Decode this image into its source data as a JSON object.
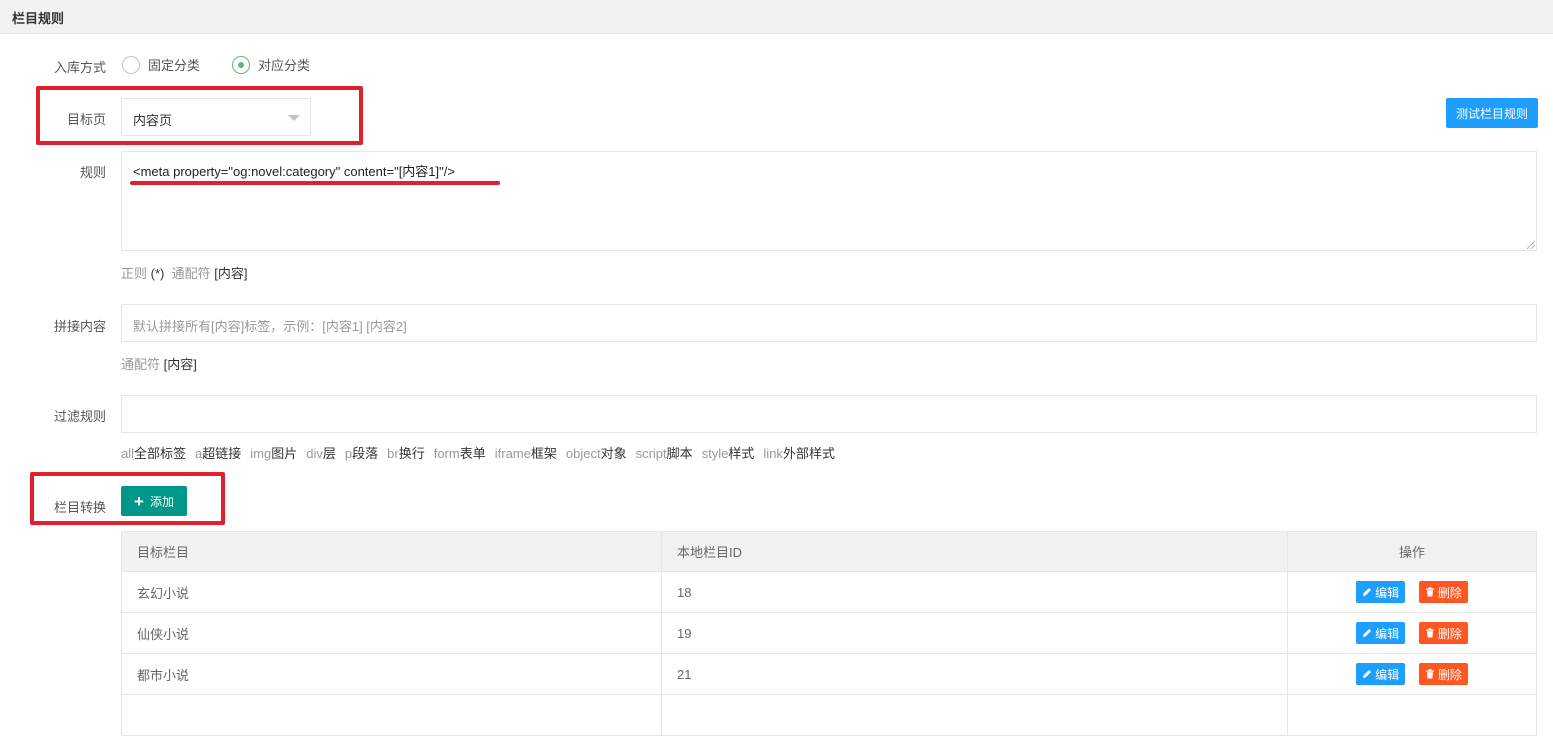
{
  "header": {
    "title": "栏目规则"
  },
  "storage_mode": {
    "label": "入库方式",
    "options": [
      {
        "label": "固定分类",
        "checked": false
      },
      {
        "label": "对应分类",
        "checked": true
      }
    ]
  },
  "target_page": {
    "label": "目标页",
    "selected": "内容页"
  },
  "test_button": {
    "label": "测试栏目规则"
  },
  "rule": {
    "label": "规则",
    "value": "<meta property=\"og:novel:category\" content=\"[内容1]\"/>",
    "hint_prefix": "正则",
    "hint_regex": "(*)",
    "hint_wildcard": "通配符",
    "hint_content": "[内容]"
  },
  "concat": {
    "label": "拼接内容",
    "placeholder": "默认拼接所有[内容]标签，示例：[内容1] [内容2]",
    "hint_wildcard": "通配符",
    "hint_content": "[内容]"
  },
  "filter": {
    "label": "过滤规则",
    "value": "",
    "tags": [
      {
        "key": "all",
        "name": "全部标签"
      },
      {
        "key": "a",
        "name": "超链接"
      },
      {
        "key": "img",
        "name": "图片"
      },
      {
        "key": "div",
        "name": "层"
      },
      {
        "key": "p",
        "name": "段落"
      },
      {
        "key": "br",
        "name": "换行"
      },
      {
        "key": "form",
        "name": "表单"
      },
      {
        "key": "iframe",
        "name": "框架"
      },
      {
        "key": "object",
        "name": "对象"
      },
      {
        "key": "script",
        "name": "脚本"
      },
      {
        "key": "style",
        "name": "样式"
      },
      {
        "key": "link",
        "name": "外部样式"
      }
    ]
  },
  "category_convert": {
    "label": "栏目转换",
    "add_label": "添加",
    "table": {
      "headers": [
        "目标栏目",
        "本地栏目ID",
        "操作"
      ],
      "rows": [
        {
          "target": "玄幻小说",
          "local_id": "18"
        },
        {
          "target": "仙侠小说",
          "local_id": "19"
        },
        {
          "target": "都市小说",
          "local_id": "21"
        }
      ],
      "edit_label": "编辑",
      "delete_label": "删除"
    }
  },
  "colors": {
    "accent_blue": "#1e9fff",
    "accent_green": "#009688",
    "danger": "#ff5722",
    "radio_green": "#5fb878",
    "annotation_red": "#e0212d"
  }
}
